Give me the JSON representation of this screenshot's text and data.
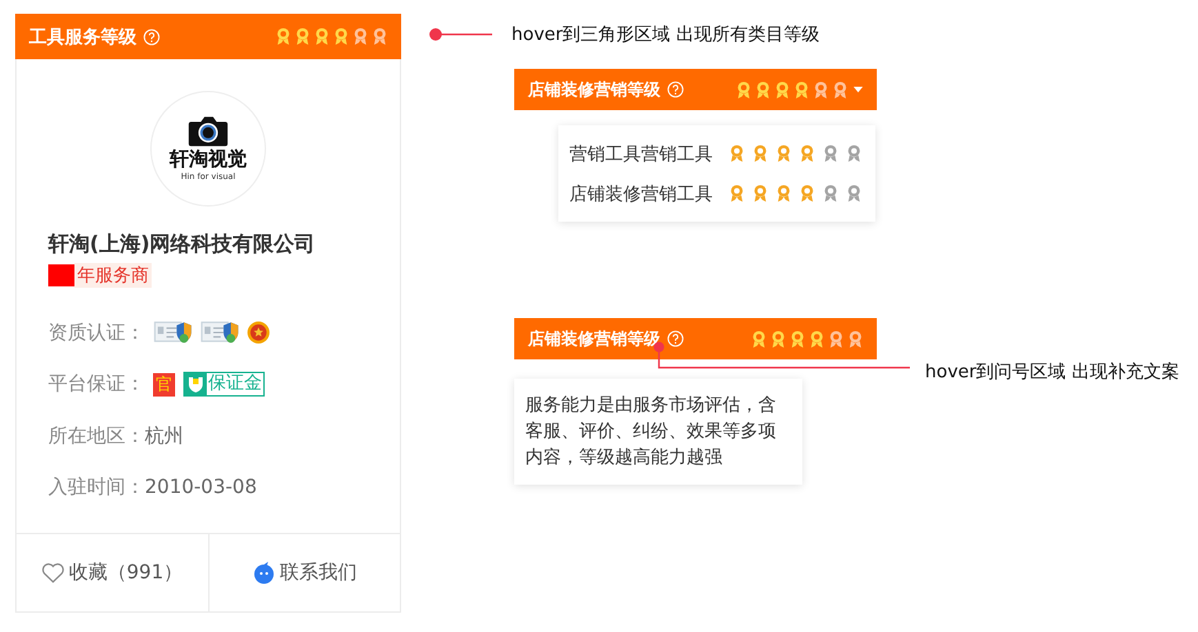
{
  "card": {
    "header": {
      "title": "工具服务等级",
      "stars": 4
    },
    "logo": {
      "title": "轩淘视觉",
      "subtitle": "Hin for visual"
    },
    "company": "轩淘(上海)网络科技有限公司",
    "badge": "年服务商",
    "rows": [
      {
        "kind": "certs",
        "label": "资质认证："
      },
      {
        "kind": "tags",
        "label": "平台保证：",
        "tags": [
          "官",
          "保证金"
        ]
      },
      {
        "kind": "text",
        "label": "所在地区：",
        "value": "杭州"
      },
      {
        "kind": "text",
        "label": "入驻时间：",
        "value": "2010-03-08"
      }
    ],
    "footer": {
      "favorite": "收藏（991）",
      "contact": "联系我们"
    }
  },
  "dropdown_demo": {
    "note": "hover到三角形区域 出现所有类目等级",
    "header": {
      "title": "店铺装修营销等级",
      "stars": 4
    },
    "items": [
      {
        "label": "营销工具营销工具",
        "stars": 4
      },
      {
        "label": "店铺装修营销工具",
        "stars": 4
      }
    ]
  },
  "tooltip_demo": {
    "note": "hover到问号区域 出现补充文案",
    "header": {
      "title": "店铺装修营销等级",
      "stars": 4
    },
    "tooltip": "服务能力是由服务市场评估，含客服、评价、纠纷、效果等多项内容，等级越高能力越强"
  }
}
